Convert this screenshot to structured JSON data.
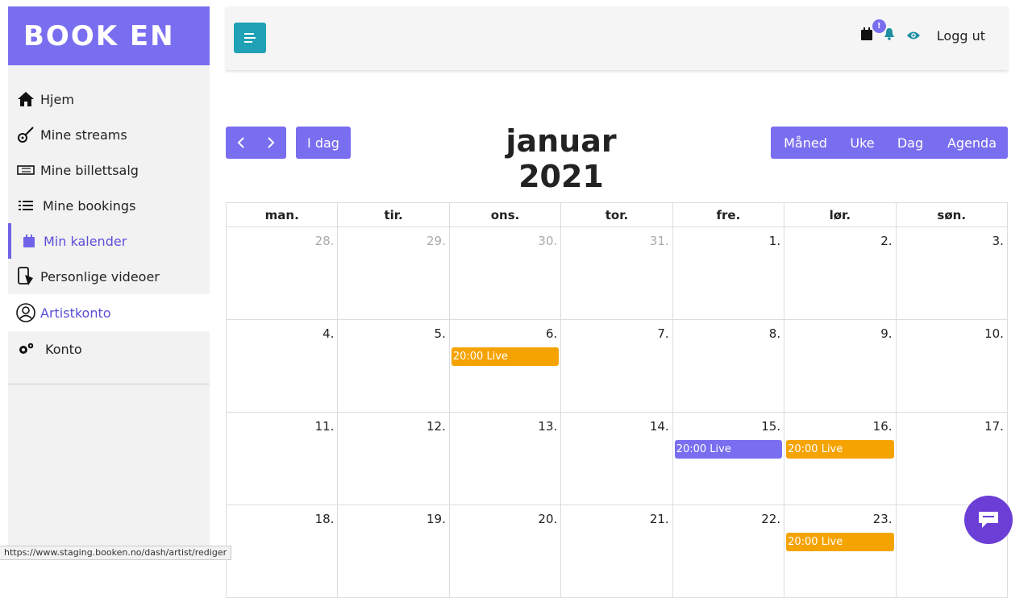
{
  "brand": {
    "logo": "BOOK EN",
    "accent": "#7a6ef0"
  },
  "sidebar": {
    "items": [
      {
        "label": "Hjem",
        "icon": "home-icon"
      },
      {
        "label": "Mine streams",
        "icon": "guitar-icon"
      },
      {
        "label": "Mine billettsalg",
        "icon": "ticket-icon"
      },
      {
        "label": "Mine bookings",
        "icon": "list-icon"
      },
      {
        "label": "Min kalender",
        "icon": "calendar-icon",
        "active": true
      },
      {
        "label": "Personlige videoer",
        "icon": "phone-video-icon"
      },
      {
        "label": "Artistkonto",
        "icon": "user-circle-icon"
      },
      {
        "label": "Konto",
        "icon": "gears-icon"
      }
    ]
  },
  "header": {
    "badge": "!",
    "logout": "Logg ut"
  },
  "toolbar": {
    "today": "I dag",
    "title": "januar 2021",
    "views": [
      "Måned",
      "Uke",
      "Dag",
      "Agenda"
    ]
  },
  "calendar": {
    "weekdays": [
      "man.",
      "tir.",
      "ons.",
      "tor.",
      "fre.",
      "lør.",
      "søn."
    ],
    "weeks": [
      [
        {
          "d": "28.",
          "o": true
        },
        {
          "d": "29.",
          "o": true
        },
        {
          "d": "30.",
          "o": true
        },
        {
          "d": "31.",
          "o": true
        },
        {
          "d": "1."
        },
        {
          "d": "2."
        },
        {
          "d": "3."
        }
      ],
      [
        {
          "d": "4."
        },
        {
          "d": "5."
        },
        {
          "d": "6.",
          "ev": "20:00 Live",
          "c": "#f5a300"
        },
        {
          "d": "7."
        },
        {
          "d": "8."
        },
        {
          "d": "9."
        },
        {
          "d": "10."
        }
      ],
      [
        {
          "d": "11."
        },
        {
          "d": "12."
        },
        {
          "d": "13."
        },
        {
          "d": "14."
        },
        {
          "d": "15.",
          "ev": "20:00 Live",
          "c": "#7a6ef0"
        },
        {
          "d": "16.",
          "ev": "20:00 Live",
          "c": "#f5a300"
        },
        {
          "d": "17."
        }
      ],
      [
        {
          "d": "18."
        },
        {
          "d": "19."
        },
        {
          "d": "20."
        },
        {
          "d": "21."
        },
        {
          "d": "22."
        },
        {
          "d": "23.",
          "ev": "20:00 Live",
          "c": "#f5a300"
        },
        {
          "d": ""
        }
      ]
    ]
  },
  "status_url": "https://www.staging.booken.no/dash/artist/rediger"
}
